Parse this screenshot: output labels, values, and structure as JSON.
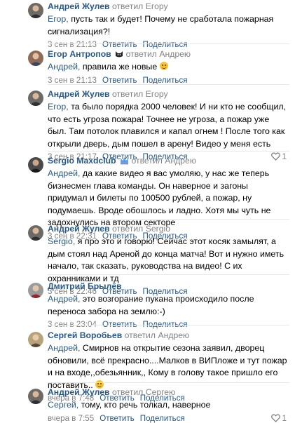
{
  "icons": {
    "like": "heart-outline-icon",
    "badge_egor": "cat-icon",
    "badge_sergio": "crown-icon"
  },
  "colors": {
    "link": "#2a5885",
    "muted": "#828282",
    "separator": "#e7e8ec"
  },
  "comments": [
    {
      "author": "Андрей Жулев",
      "replied": "ответил",
      "target": "Егору",
      "addressee": "Егор,",
      "text": " пусть так и будет! Почему не сработала пожарная сигнализация?!",
      "date": "3 сен в 21:13",
      "reply_label": "Ответить",
      "share_label": "Поделиться",
      "likes": ""
    },
    {
      "author": "Егор Антропов",
      "replied": "ответил",
      "target": "Андрею",
      "addressee": "Андрей,",
      "text": " правила же новые",
      "date": "3 сен в 21:13",
      "reply_label": "Ответить",
      "share_label": "Поделиться",
      "likes": ""
    },
    {
      "author": "Андрей Жулев",
      "replied": "ответил",
      "target": "Егору",
      "addressee": "Егор,",
      "text": " та было порядка 2000 человек! И ни кто не сообщил, что есть угроза пожара! Точнее не угроза, а пожар уже был. Там потолок плавился и капал огнем ! После того как открыли дверь, дым пошел в арену! Видео у меня есть",
      "date": "3 сен в 21:17",
      "reply_label": "Ответить",
      "share_label": "Поделиться",
      "likes": "1"
    },
    {
      "author": "Sergio Maxdclub",
      "replied": "ответил",
      "target": "Андрею",
      "addressee": "Андрей,",
      "text": " да какие видео я вас умоляю, у нас же теперь бизнесмен глава команды. Он наверное и загоны придумал и билеты по 100500 рублей, а пожар, ну подумаешь. Вроде обошлось и ладно. Хотя мы чуть не задохнулись на втором секторе",
      "date": "3 сен в 22:31",
      "reply_label": "Ответить",
      "share_label": "Поделиться",
      "likes": ""
    },
    {
      "author": "Андрей Жулев",
      "replied": "ответил",
      "target": "Sergio",
      "addressee": "Sergio,",
      "text": " я про это и говорю! Сейчас этот косяк замылят, а дым стоял над Ареной до конца матча! Вот и нужно иметь начало, так сказать, руководства на видео! С их охранниками и тд",
      "date": "3 сен в 22:46",
      "reply_label": "Ответить",
      "share_label": "Поделиться",
      "likes": ""
    },
    {
      "author": "Дмитрий Брылёв",
      "replied": "",
      "target": "",
      "addressee": "Андрей,",
      "text": " это возгорание пукана происходило после переноса забора на землю:-)",
      "date": "3 сен в 23:04",
      "reply_label": "Ответить",
      "share_label": "Поделиться",
      "likes": ""
    },
    {
      "author": "Сергей Воробьев",
      "replied": "ответил",
      "target": "Андрею",
      "addressee": "Андрей,",
      "text": " Смирнов на открытие сезона заявил, дворец обновили, всё прекрасно....Малков в ВИПложе и тут пожар и на входе,,обезьянник,, Кому в голову такое пришло его поставить..",
      "date": "вчера в 7:48",
      "reply_label": "Ответить",
      "share_label": "Поделиться",
      "likes": ""
    },
    {
      "author": "Андрей Жулев",
      "replied": "ответил",
      "target": "Сергею",
      "addressee": "Сергей,",
      "text": " тому, кто речь толкал, наверное",
      "date": "вчера в 7:55",
      "reply_label": "Ответить",
      "share_label": "Поделиться",
      "likes": "1"
    }
  ]
}
